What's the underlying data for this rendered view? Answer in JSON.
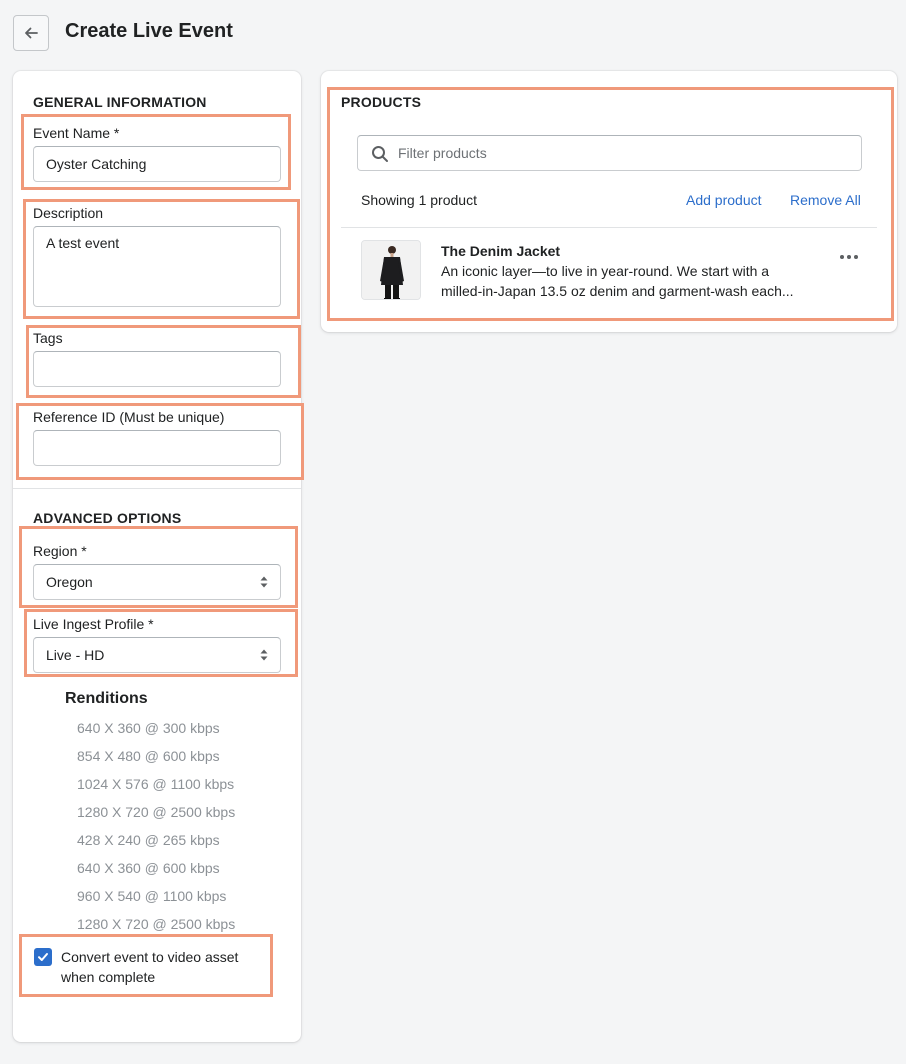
{
  "header": {
    "back_icon": "arrow-left-icon",
    "title": "Create Live Event"
  },
  "general": {
    "section_title": "GENERAL INFORMATION",
    "event_name": {
      "label": "Event Name *",
      "value": "Oyster Catching"
    },
    "description": {
      "label": "Description",
      "value": "A test event"
    },
    "tags": {
      "label": "Tags",
      "value": ""
    },
    "reference_id": {
      "label": "Reference ID (Must be unique)",
      "value": ""
    }
  },
  "advanced": {
    "section_title": "ADVANCED OPTIONS",
    "region": {
      "label": "Region *",
      "value": "Oregon"
    },
    "live_ingest_profile": {
      "label": "Live Ingest Profile *",
      "value": "Live - HD"
    },
    "renditions_title": "Renditions",
    "renditions": [
      "640 X 360 @ 300 kbps",
      "854 X 480 @ 600 kbps",
      "1024 X 576 @ 1100 kbps",
      "1280 X 720 @ 2500 kbps",
      "428 X 240 @ 265 kbps",
      "640 X 360 @ 600 kbps",
      "960 X 540 @ 1100 kbps",
      "1280 X 720 @ 2500 kbps"
    ],
    "convert_checkbox": {
      "checked": true,
      "label_line1": "Convert event to video asset",
      "label_line2": "when complete"
    }
  },
  "products": {
    "section_title": "PRODUCTS",
    "filter_placeholder": "Filter products",
    "showing_text": "Showing 1 product",
    "add_product_label": "Add product",
    "remove_all_label": "Remove All",
    "items": [
      {
        "name": "The Denim Jacket",
        "desc_line1": "An iconic layer—to live in year-round. We start with a",
        "desc_line2": "milled-in-Japan 13.5 oz denim and garment-wash each...",
        "more_icon": "ellipsis-horizontal-icon"
      }
    ]
  },
  "colors": {
    "accent": "#2c6ecb",
    "highlight": "#f0997a",
    "background": "#f4f5f6"
  }
}
